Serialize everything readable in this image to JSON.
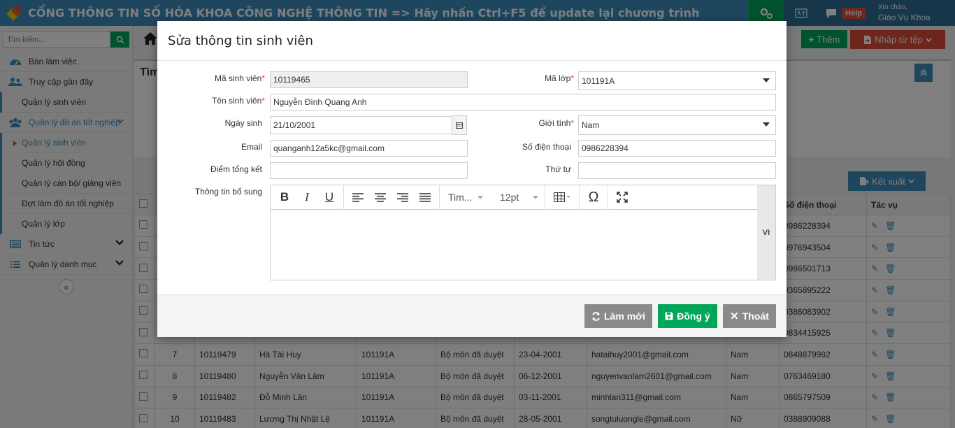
{
  "header": {
    "title": "CỔNG THÔNG TIN SỐ HÓA KHOA CÔNG NGHỆ THÔNG TIN => Hãy nhấn Ctrl+F5 để update lại chương trình",
    "help_label": "Help",
    "greeting": "Xin chào,",
    "user_name": "Giáo Vụ Khoa"
  },
  "sidebar": {
    "search_placeholder": "Tìm kiếm...",
    "items": [
      {
        "label": "Bàn làm việc",
        "icon": "dashboard-icon"
      },
      {
        "label": "Truy cập gần đây",
        "icon": "users-icon"
      },
      {
        "label": "Quản lý sinh viên"
      },
      {
        "label": "Quản lý đồ án tốt nghiệp",
        "icon": "group-icon"
      },
      {
        "label": "Quản lý sinh viên"
      },
      {
        "label": "Quản lý hội đồng"
      },
      {
        "label": "Quản lý cán bộ/ giảng viên"
      },
      {
        "label": "Đợt làm đồ án tốt nghiệp"
      },
      {
        "label": "Quản lý lớp"
      },
      {
        "label": "Tin tức",
        "icon": "news-icon"
      },
      {
        "label": "Quản lý danh mục",
        "icon": "list-icon"
      }
    ]
  },
  "main": {
    "add_label": "Thêm",
    "import_label": "Nhập từ tệp",
    "filter_title": "Tìm",
    "export_label": "Kết xuất",
    "table": {
      "headers": {
        "phone": "Số điện thoại",
        "actions": "Tác vụ"
      },
      "hidden_phones": [
        "0986228394",
        "0976943504",
        "0986501713",
        "0365895222",
        "0386083902",
        "0834415925"
      ],
      "rows": [
        {
          "stt": "7",
          "mssv": "10119479",
          "name": "Hà Tài Huy",
          "lop": "101191A",
          "status": "Bộ môn đã duyệt",
          "dob": "23-04-2001",
          "email": "hataihuy2001@gmail.com",
          "gender": "Nam",
          "phone": "0848879992"
        },
        {
          "stt": "8",
          "mssv": "10119480",
          "name": "Nguyễn Văn Lâm",
          "lop": "101191A",
          "status": "Bộ môn đã duyệt",
          "dob": "06-12-2001",
          "email": "nguyenvanlam2601@gmail.com",
          "gender": "Nam",
          "phone": "0763469180"
        },
        {
          "stt": "9",
          "mssv": "10119482",
          "name": "Đỗ Minh Lân",
          "lop": "101191A",
          "status": "Bộ môn đã duyệt",
          "dob": "03-11-2001",
          "email": "minhlan311@gmail.com",
          "gender": "Nam",
          "phone": "0865797509"
        },
        {
          "stt": "10",
          "mssv": "10119483",
          "name": "Lương Thị Nhật Lệ",
          "lop": "101191A",
          "status": "Bộ môn đã duyệt",
          "dob": "28-05-2001",
          "email": "songtuluongle@gmail.com",
          "gender": "Nữ",
          "phone": "0388909088"
        }
      ]
    }
  },
  "modal": {
    "title": "Sửa thông tin sinh viên",
    "fields": {
      "ma_sv_label": "Mã sinh viên",
      "ma_sv_value": "10119465",
      "ma_lop_label": "Mã lớp",
      "ma_lop_value": "101191A",
      "ten_label": "Tên sinh viên",
      "ten_value": "Nguyễn Đình Quang Anh",
      "ngay_sinh_label": "Ngày sinh",
      "ngay_sinh_value": "21/10/2001",
      "gioi_tinh_label": "Giới tính",
      "gioi_tinh_value": "Nam",
      "email_label": "Email",
      "email_value": "quanganh12a5kc@gmail.com",
      "sdt_label": "Số điện thoại",
      "sdt_value": "0986228394",
      "diem_label": "Điểm tổng kết",
      "diem_value": "",
      "thu_tu_label": "Thứ tự",
      "thu_tu_value": "",
      "thong_tin_label": "Thông tin bổ sung"
    },
    "editor": {
      "font_name": "Tim...",
      "font_size": "12pt",
      "lang": "VI"
    },
    "buttons": {
      "refresh": "Làm mới",
      "ok": "Đồng ý",
      "close": "Thoát"
    }
  },
  "colors": {
    "primary": "#3c8dbc",
    "success": "#00a65a",
    "danger": "#dd4b39",
    "muted_button": "#8a8a8a"
  }
}
